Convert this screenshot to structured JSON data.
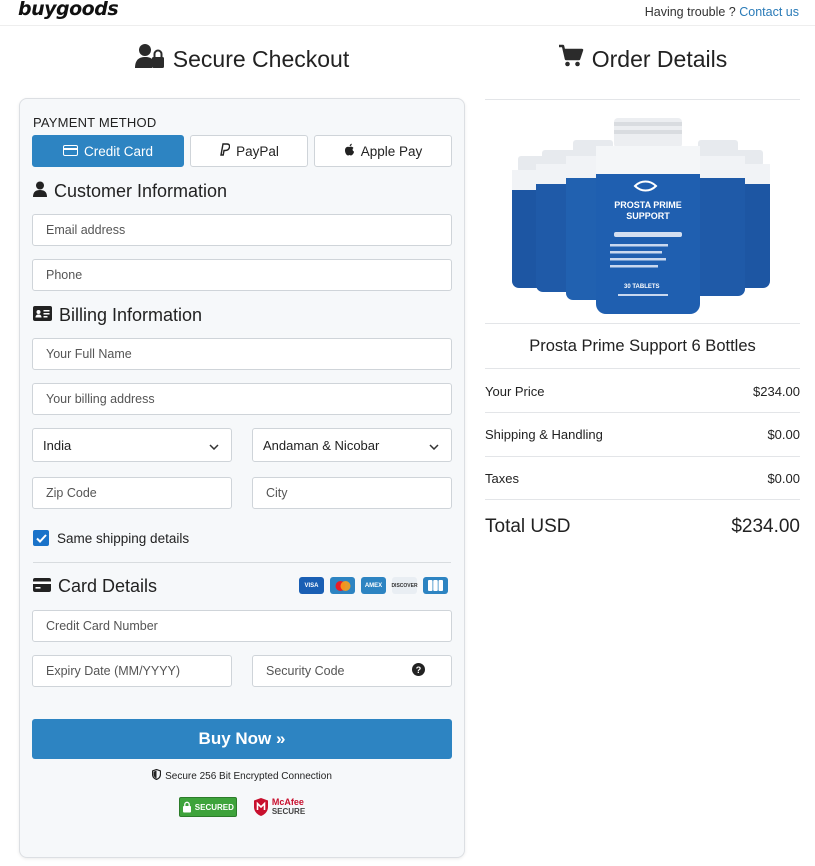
{
  "header": {
    "logo": "buygoods",
    "help_text": "Having trouble ?",
    "help_link": "Contact us"
  },
  "checkout": {
    "title": "Secure Checkout",
    "payment_method_label": "PAYMENT METHOD",
    "tabs": [
      {
        "label": "Credit Card",
        "active": true
      },
      {
        "label": "PayPal",
        "active": false
      },
      {
        "label": "Apple Pay",
        "active": false
      }
    ],
    "customer_title": "Customer Information",
    "email_placeholder": "Email address",
    "phone_placeholder": "Phone",
    "billing_title": "Billing Information",
    "fullname_placeholder": "Your Full Name",
    "address_placeholder": "Your billing address",
    "country_value": "India",
    "state_value": "Andaman & Nicobar",
    "zip_placeholder": "Zip Code",
    "city_placeholder": "City",
    "same_shipping_label": "Same shipping details",
    "same_shipping_checked": true,
    "card_title": "Card Details",
    "card_logos": [
      "VISA",
      "mastercard",
      "AMEX",
      "DISCOVER",
      "JCB"
    ],
    "card_number_placeholder": "Credit Card Number",
    "expiry_placeholder": "Expiry Date (MM/YYYY)",
    "cvv_placeholder": "Security Code",
    "buy_label": "Buy Now »",
    "secure_text": "Secure 256 Bit Encrypted Connection",
    "badge_secured": "SECURED",
    "badge_mcafee": "McAfee",
    "badge_mcafee_sub": "SECURE"
  },
  "order": {
    "title": "Order Details",
    "product_name": "Prosta Prime Support 6 Bottles",
    "bottle_label": "PROSTA PRIME SUPPORT",
    "bottle_count": "30 TABLETS",
    "rows": [
      {
        "label": "Your Price",
        "value": "$234.00"
      },
      {
        "label": "Shipping & Handling",
        "value": "$0.00"
      },
      {
        "label": "Taxes",
        "value": "$0.00"
      }
    ],
    "total_label": "Total USD",
    "total_value": "$234.00"
  },
  "colors": {
    "accent": "#2d84c2",
    "checkbox": "#1a73c9",
    "link": "#2a7bb8"
  }
}
